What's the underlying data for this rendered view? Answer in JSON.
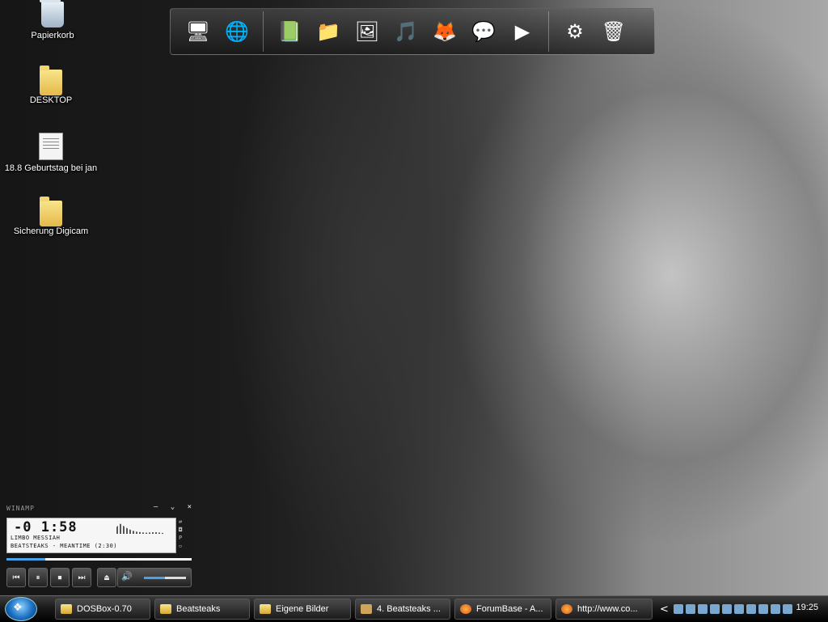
{
  "desktop": {
    "icons": [
      {
        "label": "Papierkorb",
        "icon": "recycle-bin-icon"
      },
      {
        "label": "DESKTOP",
        "icon": "folder-icon"
      },
      {
        "label": "18.8 Geburtstag bei jan",
        "icon": "text-document-icon"
      },
      {
        "label": "Sicherung Digicam",
        "icon": "folder-icon"
      }
    ]
  },
  "dock": {
    "items": [
      {
        "icon": "computer-icon",
        "glyph": "🖥"
      },
      {
        "icon": "network-icon",
        "glyph": "🌐"
      },
      {
        "icon": "book-icon",
        "glyph": "📗"
      },
      {
        "icon": "documents-folder-icon",
        "glyph": "📁"
      },
      {
        "icon": "pictures-folder-icon",
        "glyph": "🖼"
      },
      {
        "icon": "music-folder-icon",
        "glyph": "🎵"
      },
      {
        "icon": "firefox-icon",
        "glyph": "🦊"
      },
      {
        "icon": "messenger-icon",
        "glyph": "💬"
      },
      {
        "icon": "media-player-icon",
        "glyph": "▶"
      },
      {
        "icon": "settings-gear-icon",
        "glyph": "⚙"
      },
      {
        "icon": "recycle-bin-icon",
        "glyph": "🗑"
      }
    ]
  },
  "winamp": {
    "title": "WINAMP",
    "minimize": "–",
    "shade": "⌄",
    "close": "×",
    "time": "-0 1:58",
    "song": "LIMBO MESSIAH",
    "artist": "BEATSTEAKS - MEANTIME (2:30)",
    "side_controls": [
      "⇄",
      "◘",
      "P",
      "▫"
    ],
    "progress": 0.21,
    "volume": 0.5,
    "buttons": {
      "prev": "⏮",
      "pause": "⏸",
      "stop": "⏹",
      "next": "⏭",
      "eject": "⏏",
      "volume": "🔊"
    }
  },
  "taskbar": {
    "start_glyph": "❖",
    "tasks": [
      {
        "label": "DOSBox-0.70",
        "icon": "folder-icon"
      },
      {
        "label": "Beatsteaks",
        "icon": "folder-icon"
      },
      {
        "label": "Eigene Bilder",
        "icon": "folder-icon"
      },
      {
        "label": "4. Beatsteaks ...",
        "icon": "app-icon"
      },
      {
        "label": "ForumBase - A...",
        "icon": "firefox-icon"
      },
      {
        "label": "http://www.co...",
        "icon": "firefox-icon"
      }
    ],
    "tray_chevron": "<",
    "clock": "19:25"
  }
}
